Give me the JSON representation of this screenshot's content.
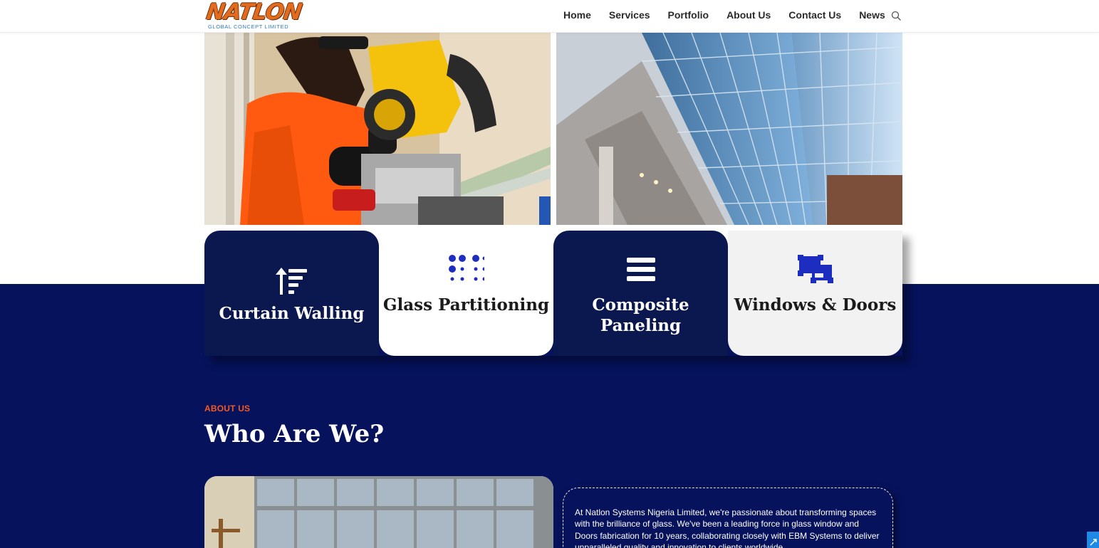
{
  "logo": {
    "name": "NATLON",
    "tagline": "GLOBAL CONCEPT LIMITED"
  },
  "nav": {
    "items": [
      "Home",
      "Services",
      "Portfolio",
      "About Us",
      "Contact Us",
      "News"
    ]
  },
  "services": [
    {
      "title": "Curtain Walling",
      "icon": "sort-amount-up-icon"
    },
    {
      "title": "Glass Partitioning",
      "icon": "dots-grid-icon"
    },
    {
      "title": "Composite Paneling",
      "icon": "bars-icon"
    },
    {
      "title": "Windows & Doors",
      "icon": "object-group-icon"
    }
  ],
  "about": {
    "eyebrow": "ABOUT US",
    "title": "Who Are We?",
    "text": "At Natlon Systems Nigeria Limited, we're passionate about transforming spaces with the brilliance of glass. We've been a leading force in glass window and Doors fabrication for 10 years, collaborating closely with EBM Systems to deliver unparalleled quality and innovation to clients worldwide."
  },
  "colors": {
    "brand_navy": "#06125c",
    "card_dark": "#0b1850",
    "accent_orange": "#f15a24",
    "icon_blue": "#1c2dbf",
    "logo_orange": "#e26b1e",
    "logo_blue": "#2e7bc4"
  }
}
